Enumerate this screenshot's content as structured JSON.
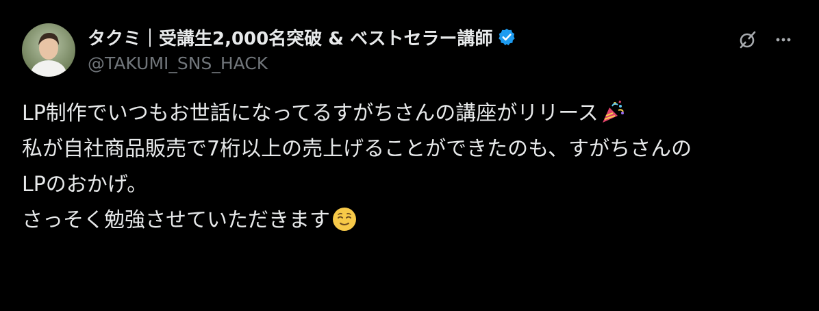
{
  "tweet": {
    "display_name": "タクミ｜受講生2,000名突破 & ベストセラー講師",
    "handle": "@TAKUMI_SNS_HACK",
    "verified": true,
    "paragraphs": [
      "LP制作でいつもお世話になってるすがちさんの講座がリリース",
      "",
      "私が自社商品販売で7桁以上の売上げることができたのも、すがちさんの\nLPのおかげ。",
      "",
      "さっそく勉強させていただきます"
    ],
    "emojis": [
      "party-popper-icon",
      "relieved-face-icon"
    ]
  },
  "colors": {
    "background": "#000000",
    "text_primary": "#e7e9ea",
    "text_secondary": "#71767b",
    "verified_blue": "#1d9bf0"
  },
  "icons": {
    "grok": "grok-icon",
    "more": "more-icon",
    "verified": "verified-badge-icon"
  }
}
